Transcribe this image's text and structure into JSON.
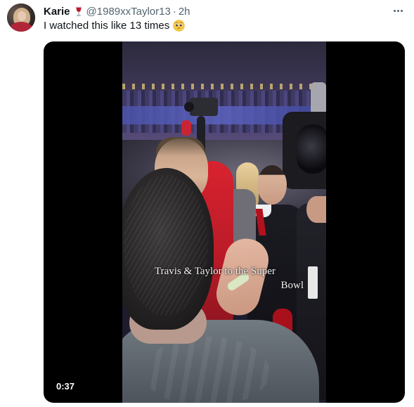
{
  "tweet": {
    "author_name": "Karie",
    "author_handle": "@1989xxTaylor13",
    "separator": "·",
    "time": "2h",
    "text": "I watched this like 13 times",
    "name_icon": "wine-glass-icon",
    "text_emoji": "pleading-face-emoji",
    "more_icon": "more-options-icon"
  },
  "video": {
    "caption_line1": "Travis & Taylor to the Super",
    "caption_line2": "Bowl",
    "duration": "0:37"
  }
}
